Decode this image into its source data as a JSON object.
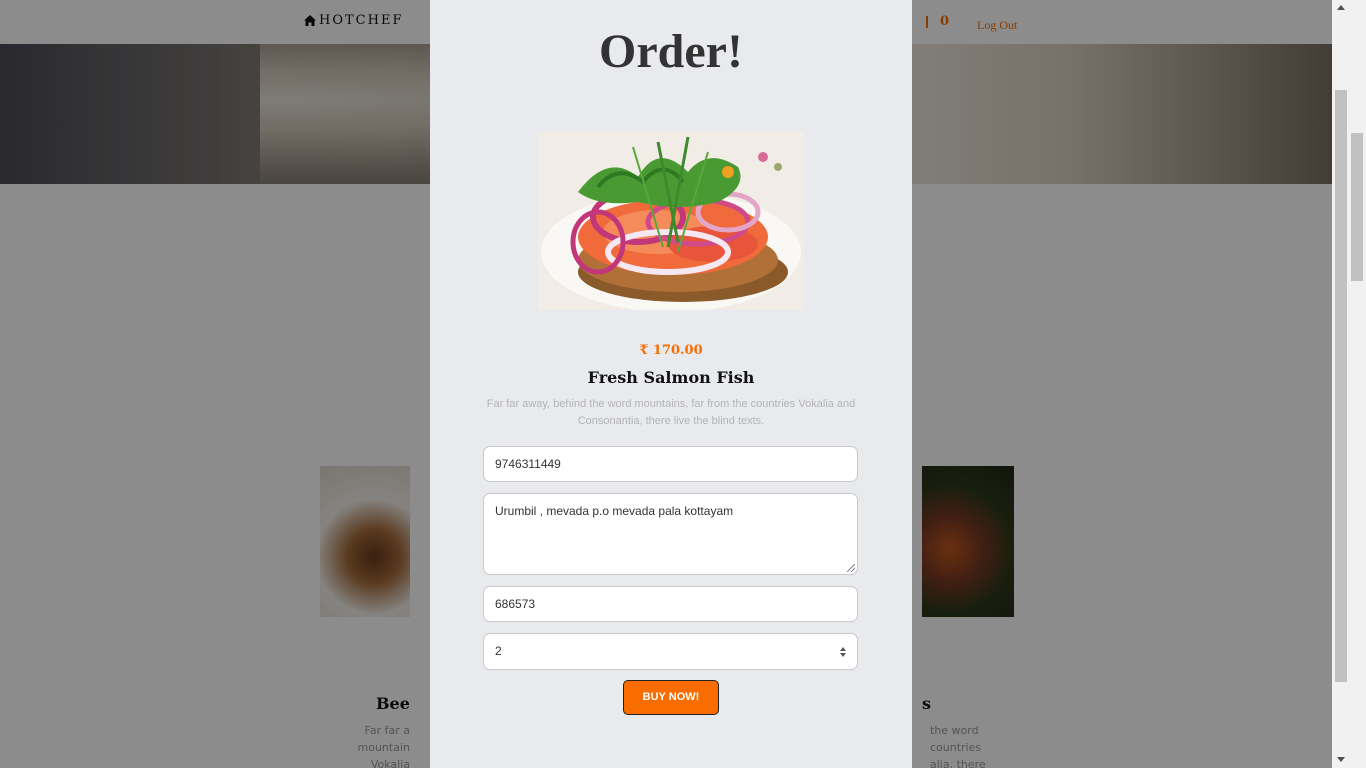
{
  "navbar": {
    "brand": "HOTCHEF",
    "cart_count": "0",
    "logout_label": "Log Out"
  },
  "background_menu": {
    "left_title": "Bee",
    "left_desc": "Far far a mountain Vokalia",
    "right_title": "s",
    "right_desc": "the word countries alia, there"
  },
  "modal": {
    "title": "Order!",
    "product": {
      "price": "₹ 170.00",
      "name": "Fresh Salmon Fish",
      "description": "Far far away, behind the word mountains, far from the countries Vokalia and Consonantia, there live the blind texts."
    },
    "form": {
      "phone_value": "9746311449",
      "address_value": "Urumbil , mevada p.o mevada pala kottayam",
      "pincode_value": "686573",
      "quantity_value": "2",
      "submit_label": "BUY NOW!"
    }
  },
  "colors": {
    "accent": "#f96d00",
    "modal_bg": "#e8eaed"
  },
  "icons": {
    "brand_icon": "home-icon",
    "cart_icon": "cart-icon"
  }
}
